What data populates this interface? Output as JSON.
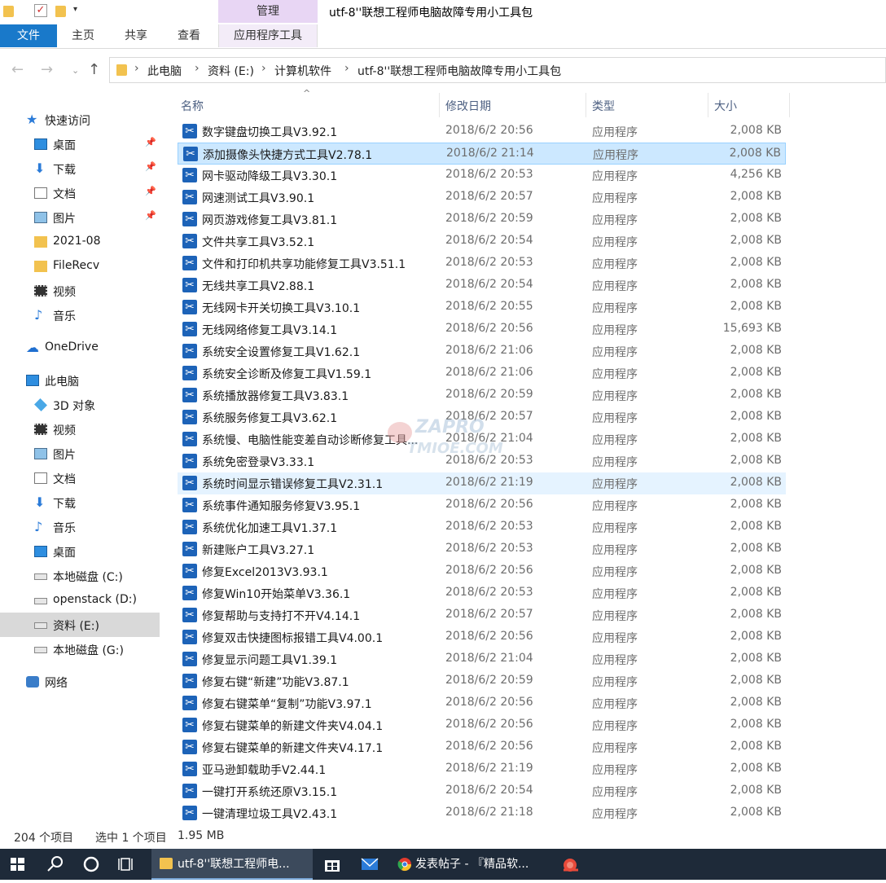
{
  "window": {
    "title": "utf-8''联想工程师电脑故障专用小工具包",
    "context_group": "管理"
  },
  "ribbon": {
    "tabs": [
      "文件",
      "主页",
      "共享",
      "查看",
      "应用程序工具"
    ]
  },
  "address": {
    "crumbs": [
      "此电脑",
      "资料 (E:)",
      "计算机软件",
      "utf-8''联想工程师电脑故障专用小工具包"
    ]
  },
  "sidebar": {
    "items": [
      {
        "label": "快速访问",
        "icon": "star-icon"
      },
      {
        "label": "桌面",
        "icon": "desktop-icon",
        "pinned": true
      },
      {
        "label": "下载",
        "icon": "download-icon",
        "pinned": true
      },
      {
        "label": "文档",
        "icon": "document-icon",
        "pinned": true
      },
      {
        "label": "图片",
        "icon": "pictures-icon",
        "pinned": true
      },
      {
        "label": "2021-08",
        "icon": "folder-icon"
      },
      {
        "label": "FileRecv",
        "icon": "folder-icon"
      },
      {
        "label": "视频",
        "icon": "video-icon"
      },
      {
        "label": "音乐",
        "icon": "music-icon"
      },
      {
        "label": "OneDrive",
        "icon": "cloud-icon"
      },
      {
        "label": "此电脑",
        "icon": "computer-icon"
      },
      {
        "label": "3D 对象",
        "icon": "cube-icon"
      },
      {
        "label": "视频",
        "icon": "video-icon"
      },
      {
        "label": "图片",
        "icon": "pictures-icon"
      },
      {
        "label": "文档",
        "icon": "document-icon"
      },
      {
        "label": "下载",
        "icon": "download-icon"
      },
      {
        "label": "音乐",
        "icon": "music-icon"
      },
      {
        "label": "桌面",
        "icon": "desktop-icon"
      },
      {
        "label": "本地磁盘 (C:)",
        "icon": "drive-icon"
      },
      {
        "label": "openstack (D:)",
        "icon": "drive-icon"
      },
      {
        "label": "资料 (E:)",
        "icon": "drive-icon",
        "selected": true
      },
      {
        "label": "本地磁盘 (G:)",
        "icon": "drive-icon"
      },
      {
        "label": "网络",
        "icon": "network-icon"
      }
    ]
  },
  "columns": {
    "name": "名称",
    "date": "修改日期",
    "type": "类型",
    "size": "大小"
  },
  "files": [
    {
      "name": "数字键盘切换工具V3.92.1",
      "date": "2018/6/2 20:56",
      "type": "应用程序",
      "size": "2,008 KB"
    },
    {
      "name": "添加摄像头快捷方式工具V2.78.1",
      "date": "2018/6/2 21:14",
      "type": "应用程序",
      "size": "2,008 KB",
      "selected": true
    },
    {
      "name": "网卡驱动降级工具V3.30.1",
      "date": "2018/6/2 20:53",
      "type": "应用程序",
      "size": "4,256 KB"
    },
    {
      "name": "网速测试工具V3.90.1",
      "date": "2018/6/2 20:57",
      "type": "应用程序",
      "size": "2,008 KB"
    },
    {
      "name": "网页游戏修复工具V3.81.1",
      "date": "2018/6/2 20:59",
      "type": "应用程序",
      "size": "2,008 KB"
    },
    {
      "name": "文件共享工具V3.52.1",
      "date": "2018/6/2 20:54",
      "type": "应用程序",
      "size": "2,008 KB"
    },
    {
      "name": "文件和打印机共享功能修复工具V3.51.1",
      "date": "2018/6/2 20:53",
      "type": "应用程序",
      "size": "2,008 KB"
    },
    {
      "name": "无线共享工具V2.88.1",
      "date": "2018/6/2 20:54",
      "type": "应用程序",
      "size": "2,008 KB"
    },
    {
      "name": "无线网卡开关切换工具V3.10.1",
      "date": "2018/6/2 20:55",
      "type": "应用程序",
      "size": "2,008 KB"
    },
    {
      "name": "无线网络修复工具V3.14.1",
      "date": "2018/6/2 20:56",
      "type": "应用程序",
      "size": "15,693 KB"
    },
    {
      "name": "系统安全设置修复工具V1.62.1",
      "date": "2018/6/2 21:06",
      "type": "应用程序",
      "size": "2,008 KB"
    },
    {
      "name": "系统安全诊断及修复工具V1.59.1",
      "date": "2018/6/2 21:06",
      "type": "应用程序",
      "size": "2,008 KB"
    },
    {
      "name": "系统播放器修复工具V3.83.1",
      "date": "2018/6/2 20:59",
      "type": "应用程序",
      "size": "2,008 KB"
    },
    {
      "name": "系统服务修复工具V3.62.1",
      "date": "2018/6/2 20:57",
      "type": "应用程序",
      "size": "2,008 KB"
    },
    {
      "name": "系统慢、电脑性能变差自动诊断修复工具...",
      "date": "2018/6/2 21:04",
      "type": "应用程序",
      "size": "2,008 KB"
    },
    {
      "name": "系统免密登录V3.33.1",
      "date": "2018/6/2 20:53",
      "type": "应用程序",
      "size": "2,008 KB"
    },
    {
      "name": "系统时间显示错误修复工具V2.31.1",
      "date": "2018/6/2 21:19",
      "type": "应用程序",
      "size": "2,008 KB",
      "hover": true
    },
    {
      "name": "系统事件通知服务修复V3.95.1",
      "date": "2018/6/2 20:56",
      "type": "应用程序",
      "size": "2,008 KB"
    },
    {
      "name": "系统优化加速工具V1.37.1",
      "date": "2018/6/2 20:53",
      "type": "应用程序",
      "size": "2,008 KB"
    },
    {
      "name": "新建账户工具V3.27.1",
      "date": "2018/6/2 20:53",
      "type": "应用程序",
      "size": "2,008 KB"
    },
    {
      "name": "修复Excel2013V3.93.1",
      "date": "2018/6/2 20:56",
      "type": "应用程序",
      "size": "2,008 KB"
    },
    {
      "name": "修复Win10开始菜单V3.36.1",
      "date": "2018/6/2 20:53",
      "type": "应用程序",
      "size": "2,008 KB"
    },
    {
      "name": "修复帮助与支持打不开V4.14.1",
      "date": "2018/6/2 20:57",
      "type": "应用程序",
      "size": "2,008 KB"
    },
    {
      "name": "修复双击快捷图标报错工具V4.00.1",
      "date": "2018/6/2 20:56",
      "type": "应用程序",
      "size": "2,008 KB"
    },
    {
      "name": "修复显示问题工具V1.39.1",
      "date": "2018/6/2 21:04",
      "type": "应用程序",
      "size": "2,008 KB"
    },
    {
      "name": "修复右键“新建”功能V3.87.1",
      "date": "2018/6/2 20:59",
      "type": "应用程序",
      "size": "2,008 KB"
    },
    {
      "name": "修复右键菜单“复制”功能V3.97.1",
      "date": "2018/6/2 20:56",
      "type": "应用程序",
      "size": "2,008 KB"
    },
    {
      "name": "修复右键菜单的新建文件夹V4.04.1",
      "date": "2018/6/2 20:56",
      "type": "应用程序",
      "size": "2,008 KB"
    },
    {
      "name": "修复右键菜单的新建文件夹V4.17.1",
      "date": "2018/6/2 20:56",
      "type": "应用程序",
      "size": "2,008 KB"
    },
    {
      "name": "亚马逊卸载助手V2.44.1",
      "date": "2018/6/2 21:19",
      "type": "应用程序",
      "size": "2,008 KB"
    },
    {
      "name": "一键打开系统还原V3.15.1",
      "date": "2018/6/2 20:54",
      "type": "应用程序",
      "size": "2,008 KB"
    },
    {
      "name": "一键清理垃圾工具V2.43.1",
      "date": "2018/6/2 21:18",
      "type": "应用程序",
      "size": "2,008 KB"
    }
  ],
  "watermark": {
    "top": "ZAPRO",
    "bottom": "TMIOE.COM"
  },
  "status": {
    "count": "204 个项目",
    "selection": "选中 1 个项目",
    "sel_size": "1.95 MB"
  },
  "taskbar": {
    "explorer_label": "utf-8''联想工程师电...",
    "chrome_label": "发表帖子 - 『精品软..."
  },
  "colors": {
    "accent": "#1979ca",
    "selected_row": "#cce8ff",
    "taskbar": "#1e2a39",
    "context_tab": "#e8d6f4"
  }
}
